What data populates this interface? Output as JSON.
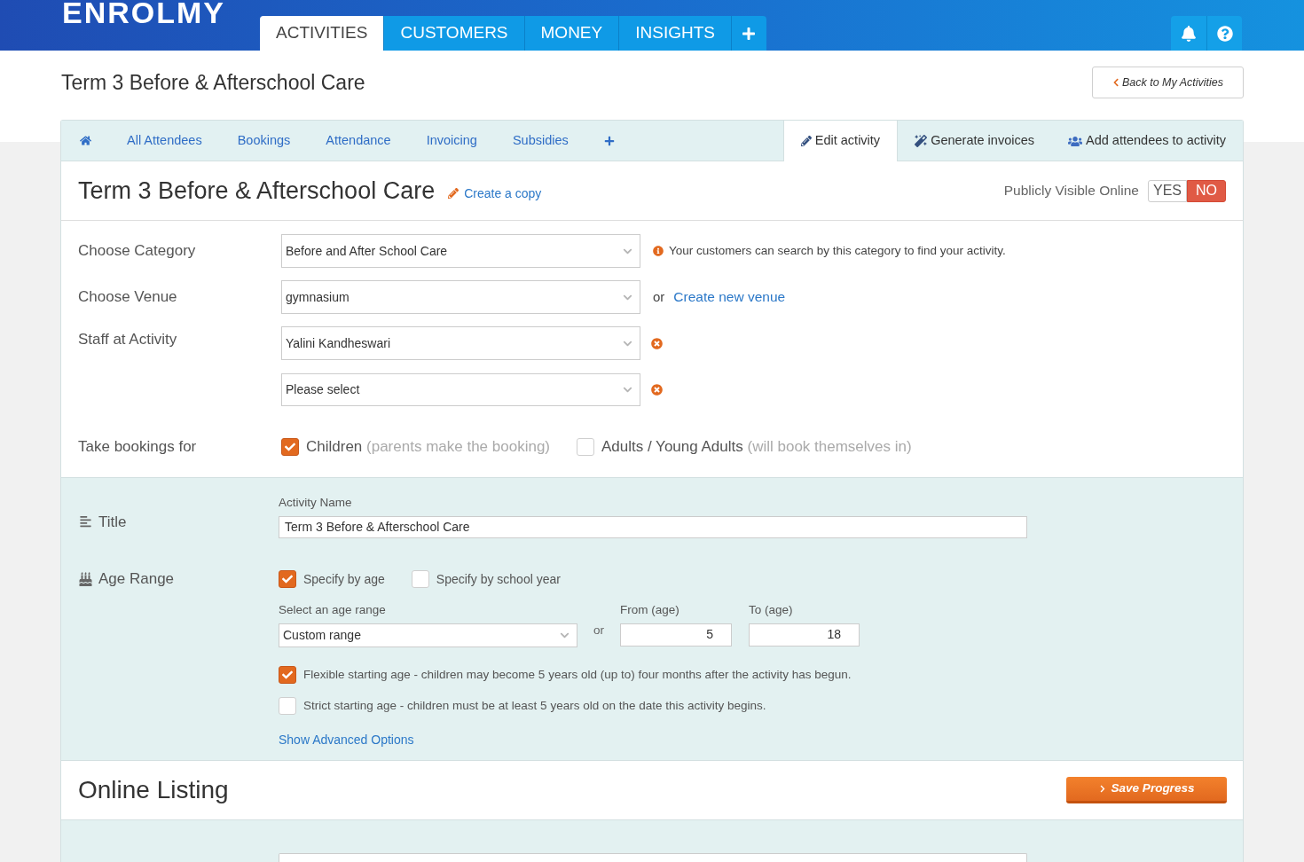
{
  "header": {
    "logo": "ENROLMY",
    "nav_tabs": [
      {
        "kind": "page",
        "label": "ACTIVITIES",
        "selected": true
      },
      {
        "kind": "page",
        "label": "CUSTOMERS",
        "selected": false
      },
      {
        "kind": "page",
        "label": "MONEY",
        "selected": false
      },
      {
        "kind": "page",
        "label": "INSIGHTS",
        "selected": false
      },
      {
        "kind": "add",
        "selected": false
      }
    ]
  },
  "page": {
    "title": "Term 3 Before & Afterschool Care",
    "back_button": "Back to My Activities"
  },
  "section_tabs": [
    {
      "kind": "home",
      "selected": false
    },
    {
      "kind": "page",
      "label": "All Attendees",
      "selected": false
    },
    {
      "kind": "page",
      "label": "Bookings",
      "selected": false
    },
    {
      "kind": "page",
      "label": "Attendance",
      "selected": false
    },
    {
      "kind": "page",
      "label": "Invoicing",
      "selected": false
    },
    {
      "kind": "page",
      "label": "Subsidies",
      "selected": false
    },
    {
      "kind": "add",
      "selected": false
    }
  ],
  "action_tabs": [
    {
      "kind": "edit",
      "label": "Edit activity",
      "selected": true
    },
    {
      "kind": "invoices",
      "label": "Generate invoices",
      "selected": false
    },
    {
      "kind": "attendees",
      "label": "Add attendees to activity",
      "selected": false
    }
  ],
  "activity": {
    "title": "Term 3 Before & Afterschool Care",
    "copy_link": "Create a copy",
    "visibility": {
      "label": "Publicly Visible Online",
      "options": [
        {
          "label": "YES",
          "selected": false
        },
        {
          "label": "NO",
          "selected": true
        }
      ]
    }
  },
  "category": {
    "label": "Choose Category",
    "value": "Before and After School Care",
    "hint": "Your customers can search by this category to find your activity."
  },
  "venue": {
    "label": "Choose Venue",
    "value": "gymnasium",
    "or": "or",
    "link": "Create new venue"
  },
  "staff": {
    "label": "Staff at Activity",
    "selects": [
      {
        "value": "Yalini Kandheswari"
      },
      {
        "value": "Please select"
      }
    ]
  },
  "bookings_for": {
    "label": "Take bookings for",
    "options": [
      {
        "label": "Children",
        "note": "(parents make the booking)",
        "checked": true
      },
      {
        "label": "Adults / Young Adults",
        "note": "(will book themselves in)",
        "checked": false
      }
    ]
  },
  "title_section": {
    "label": "Title",
    "field_label": "Activity Name",
    "value": "Term 3 Before & Afterschool Care"
  },
  "age_range": {
    "label": "Age Range",
    "modes": [
      {
        "label": "Specify by age",
        "checked": true
      },
      {
        "label": "Specify by school year",
        "checked": false
      }
    ],
    "range_select": {
      "label": "Select an age range",
      "value": "Custom range"
    },
    "or": "or",
    "from": {
      "label": "From (age)",
      "value": "5"
    },
    "to": {
      "label": "To (age)",
      "value": "18"
    },
    "rules": [
      {
        "label": "Flexible starting age - children may become 5 years old (up to) four months after the activity has begun.",
        "checked": true
      },
      {
        "label": "Strict starting age - children must be at least 5 years old on the date this activity begins.",
        "checked": false
      }
    ],
    "advanced_link": "Show Advanced Options"
  },
  "online_listing": {
    "title": "Online Listing",
    "save_button": "Save Progress"
  }
}
